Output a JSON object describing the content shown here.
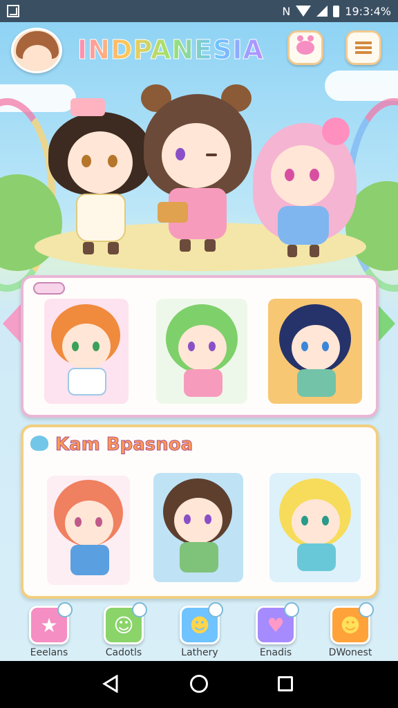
{
  "status_bar": {
    "time": "19:3:4%"
  },
  "header": {
    "title": "INDPANESIA",
    "left_icon": "player-avatar",
    "right_buttons": [
      "paw-icon",
      "menu-icon"
    ]
  },
  "section_two": {
    "title": "Kam Bpasnoa"
  },
  "bottom_nav": [
    {
      "label": "Eeelans",
      "icon": "star-icon",
      "color": "#f58ec2"
    },
    {
      "label": "Cadotls",
      "icon": "cat-icon",
      "color": "#8ad46a"
    },
    {
      "label": "Lathery",
      "icon": "smiley-icon",
      "color": "#6fc3ff"
    },
    {
      "label": "Enadis",
      "icon": "heart-icon",
      "color": "#a68bff"
    },
    {
      "label": "DWonest",
      "icon": "smiley-icon",
      "color": "#ffa23a"
    }
  ],
  "colors": {
    "accent_pink": "#f58ec2",
    "accent_gold": "#f2cf7f",
    "status_bar": "#3a4f62"
  }
}
